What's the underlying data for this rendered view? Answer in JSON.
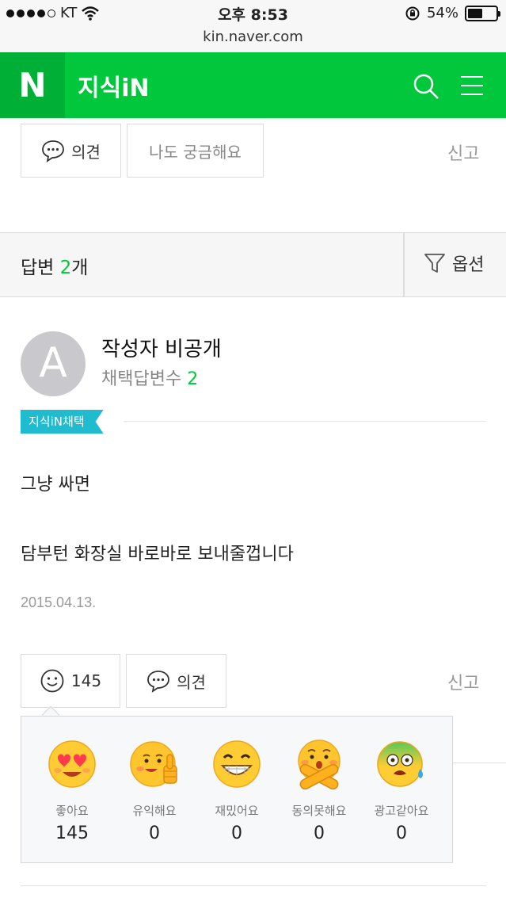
{
  "status_bar": {
    "carrier": "KT",
    "time": "오후 8:53",
    "battery": "54%",
    "battery_level": 0.54
  },
  "url": "kin.naver.com",
  "header": {
    "logo": "N",
    "title": "지식iN"
  },
  "question_actions": {
    "opinion_label": "의견",
    "curious_label": "나도 궁금해요",
    "report_label": "신고"
  },
  "answers_header": {
    "label": "답변 ",
    "count": "2",
    "unit": "개",
    "options_label": "옵션"
  },
  "answer": {
    "author": "작성자 비공개",
    "adopted_label": "채택답변수 ",
    "adopted_count": "2",
    "badge": "지식iN채택",
    "line1": "그냥 싸면",
    "line2": "담부턴 화장실 바로바로 보내줄껍니다",
    "date": "2015.04.13.",
    "like_count": "145",
    "opinion_label": "의견",
    "report_label": "신고"
  },
  "reactions": [
    {
      "label": "좋아요",
      "count": "145",
      "icon": "heart-eyes-icon"
    },
    {
      "label": "유익해요",
      "count": "0",
      "icon": "thumbs-up-face-icon"
    },
    {
      "label": "재밌어요",
      "count": "0",
      "icon": "grin-icon"
    },
    {
      "label": "동의못해요",
      "count": "0",
      "icon": "crossed-arms-face-icon"
    },
    {
      "label": "광고같아요",
      "count": "0",
      "icon": "sick-face-icon"
    }
  ],
  "colors": {
    "brand_green": "#00c73c",
    "brand_green_dark": "#00b036",
    "badge_teal": "#1fbccf"
  }
}
